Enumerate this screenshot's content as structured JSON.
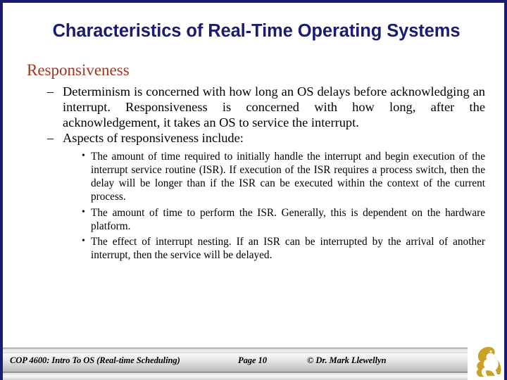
{
  "slide": {
    "title": "Characteristics of Real-Time Operating Systems",
    "title_color": "#1b1b72",
    "border_color": "#1b1b72",
    "background": "#ffffff"
  },
  "content": {
    "heading": {
      "text": "Responsiveness",
      "color": "#a33520"
    },
    "dash_marker": "–",
    "bullet_marker": "•",
    "level2": [
      {
        "marker": "–",
        "text": "Determinism is concerned with how long an OS delays before acknowledging an interrupt.  Responsiveness is concerned with how long, after the acknowledgement, it takes an OS to service the interrupt."
      },
      {
        "marker": "–",
        "text": "Aspects of responsiveness include:"
      }
    ],
    "level3": [
      {
        "marker": "•",
        "text": "The amount of time required to initially handle the interrupt and begin execution of the interrupt service routine (ISR).  If execution of the ISR requires a process switch, then the delay will be longer than if the ISR can be executed within the context of the current process."
      },
      {
        "marker": "•",
        "text": "The amount of time to perform the ISR.   Generally, this is dependent on the hardware platform."
      },
      {
        "marker": "•",
        "text": "The effect of interrupt nesting.  If an ISR can be interrupted by the arrival of another interrupt, then the service will be delayed."
      }
    ]
  },
  "footer": {
    "course": "COP 4600: Intro To OS  (Real-time Scheduling)",
    "page": "Page 10",
    "copyright": "© Dr. Mark Llewellyn",
    "logo_name": "ucf-pegasus-logo",
    "logo_color": "#c9a227"
  }
}
